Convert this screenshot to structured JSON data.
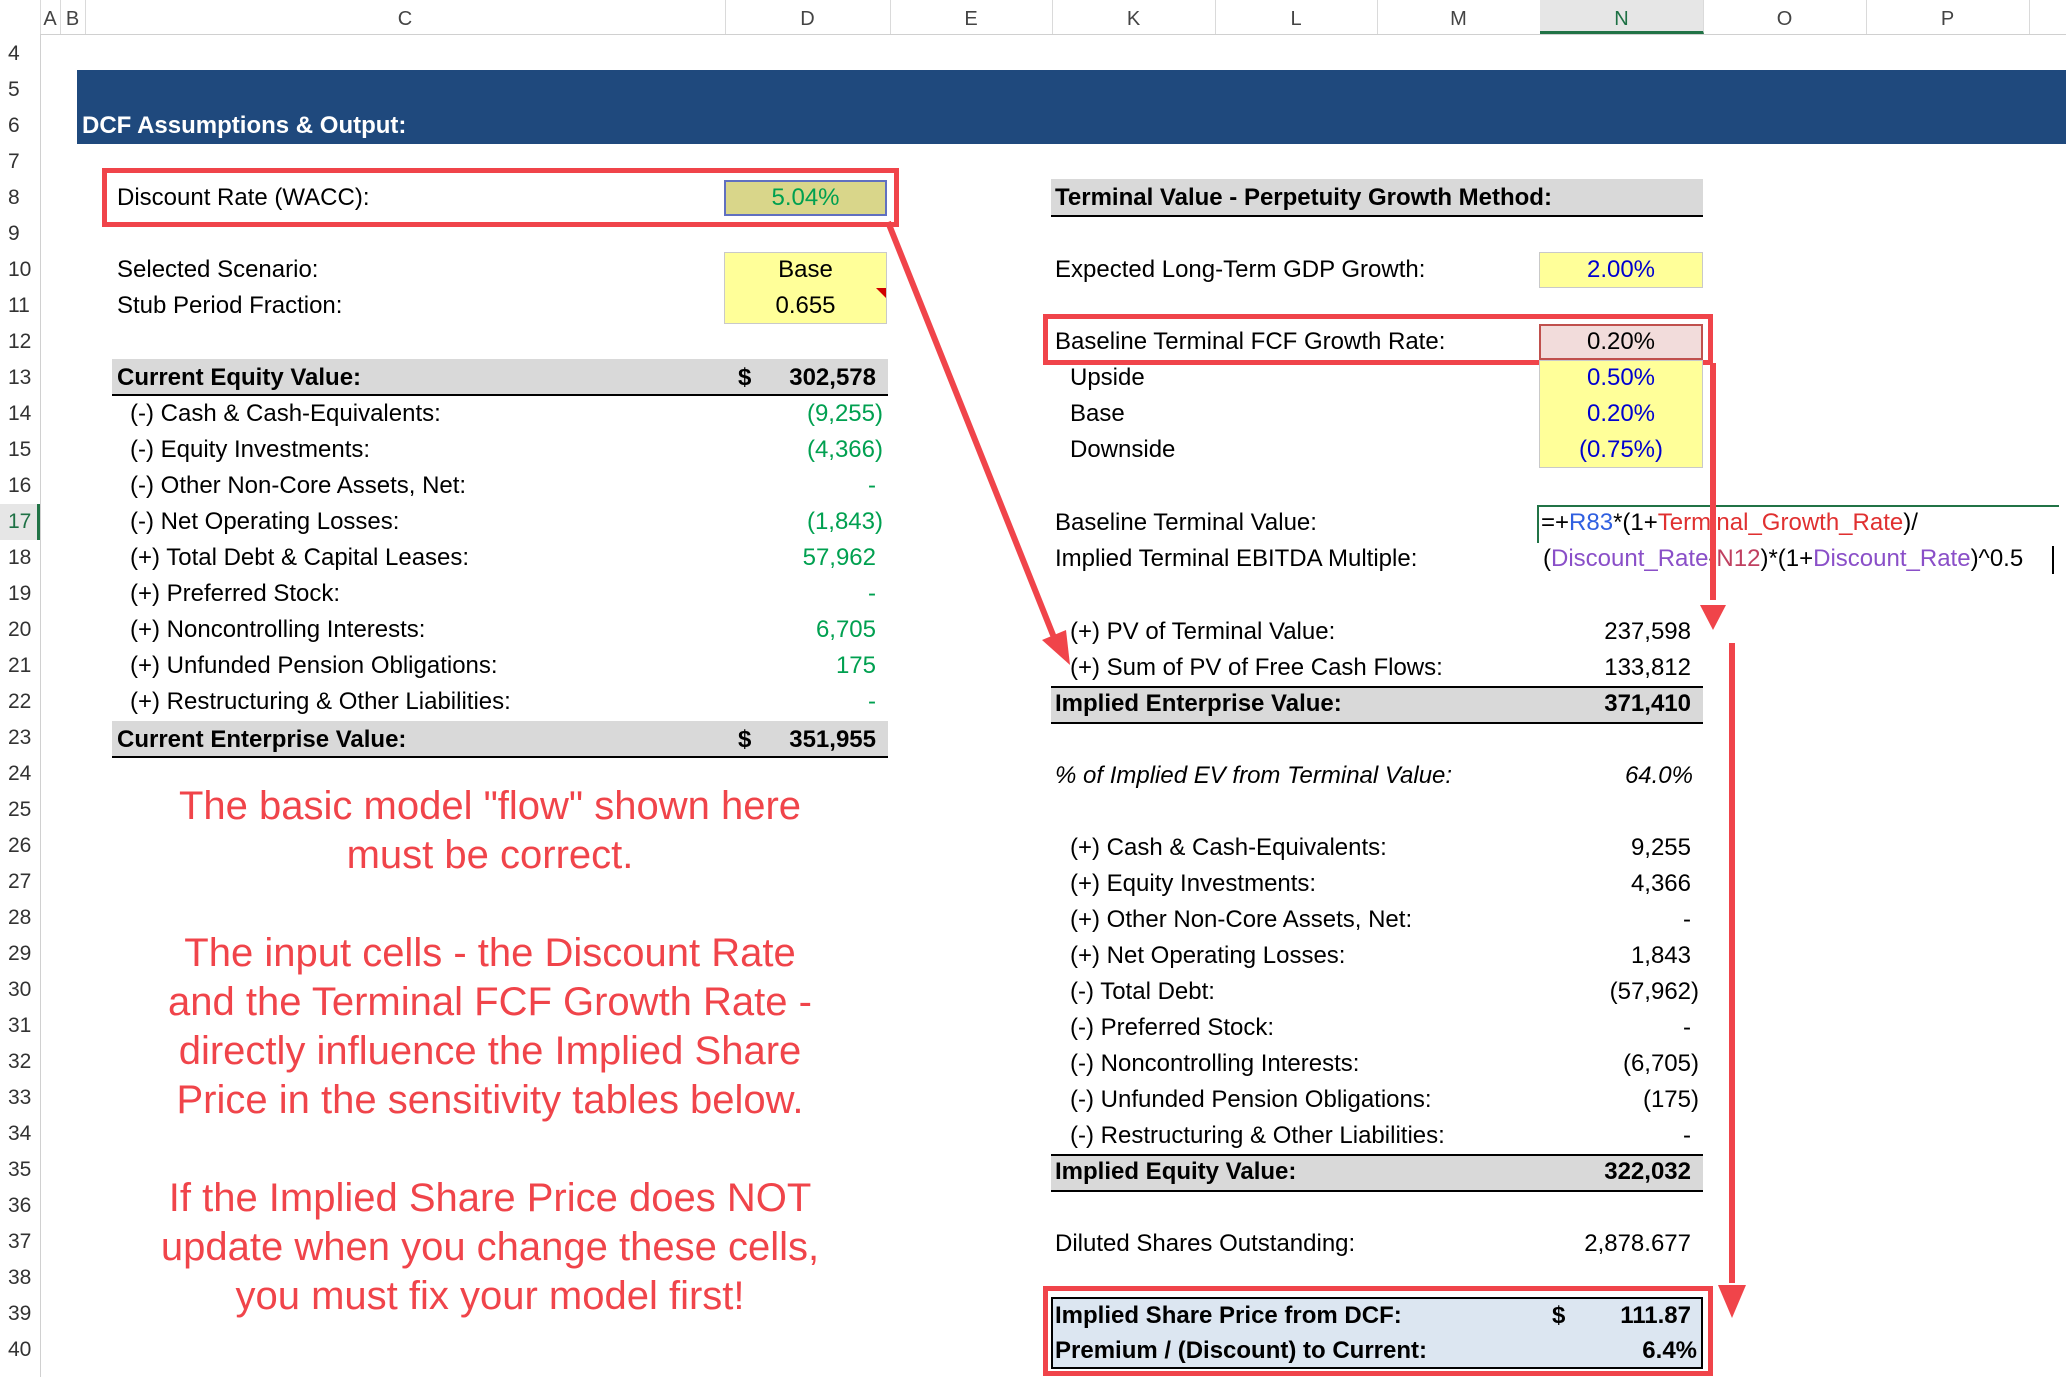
{
  "columns": [
    "A",
    "B",
    "C",
    "D",
    "E",
    "K",
    "L",
    "M",
    "N",
    "O",
    "P"
  ],
  "rows": [
    "4",
    "5",
    "6",
    "7",
    "8",
    "9",
    "10",
    "11",
    "12",
    "13",
    "14",
    "15",
    "16",
    "17",
    "18",
    "19",
    "20",
    "21",
    "22",
    "23",
    "24",
    "25",
    "26",
    "27",
    "28",
    "29",
    "30",
    "31",
    "32",
    "33",
    "34",
    "35",
    "36",
    "37",
    "38",
    "39",
    "40"
  ],
  "selected_column": "N",
  "selected_row": "17",
  "banner_title": "DCF Assumptions & Output:",
  "left": {
    "discount_label": "Discount Rate (WACC):",
    "discount_value": "5.04%",
    "scenario_label": "Selected Scenario:",
    "scenario_value": "Base",
    "stub_label": "Stub Period Fraction:",
    "stub_value": "0.655",
    "equity_label": "Current Equity Value:",
    "equity_currency": "$",
    "equity_value": "302,578",
    "items": [
      {
        "label": "(-) Cash & Cash-Equivalents:",
        "value": "(9,255)"
      },
      {
        "label": "(-) Equity Investments:",
        "value": "(4,366)"
      },
      {
        "label": "(-) Other Non-Core Assets, Net:",
        "value": "-"
      },
      {
        "label": "(-) Net Operating Losses:",
        "value": "(1,843)"
      },
      {
        "label": "(+) Total Debt & Capital Leases:",
        "value": "57,962"
      },
      {
        "label": "(+) Preferred Stock:",
        "value": "-"
      },
      {
        "label": "(+) Noncontrolling Interests:",
        "value": "6,705"
      },
      {
        "label": "(+) Unfunded Pension Obligations:",
        "value": "175"
      },
      {
        "label": "(+) Restructuring & Other Liabilities:",
        "value": "-"
      }
    ],
    "ev_label": "Current Enterprise Value:",
    "ev_currency": "$",
    "ev_value": "351,955"
  },
  "note": {
    "p1a": "The basic model \"flow\" shown here",
    "p1b": "must be correct.",
    "p2a": "The input cells - the Discount Rate",
    "p2b": "and the Terminal FCF Growth Rate -",
    "p2c": "directly influence the Implied Share",
    "p2d": "Price in the sensitivity tables below.",
    "p3a": "If the Implied Share Price does NOT",
    "p3b": "update when you change these cells,",
    "p3c": "you must fix your model first!"
  },
  "right": {
    "tv_header": "Terminal Value - Perpetuity Growth Method:",
    "gdp_label": "Expected Long-Term GDP Growth:",
    "gdp_value": "2.00%",
    "baseline_growth_label": "Baseline Terminal FCF Growth Rate:",
    "baseline_growth_value": "0.20%",
    "scenarios": [
      {
        "label": "Upside",
        "value": "0.50%"
      },
      {
        "label": "Base",
        "value": "0.20%"
      },
      {
        "label": "Downside",
        "value": "(0.75%)"
      }
    ],
    "btv_label": "Baseline Terminal Value:",
    "ebitda_label": "Implied Terminal EBITDA Multiple:",
    "formula_line1": {
      "p1": "=+",
      "p2": "R83",
      "p3": "*(1+",
      "p4": "Terminal_Growth_Rate",
      "p5": ")/"
    },
    "formula_line2": {
      "p1": "(",
      "p2": "Discount_Rate",
      "p3": "-",
      "p4": "N12",
      "p5": ")*(1+",
      "p6": "Discount_Rate",
      "p7": ")^0.5"
    },
    "pv_tv_label": "(+) PV of Terminal Value:",
    "pv_tv_value": "237,598",
    "pv_fcf_label": "(+) Sum of PV of Free Cash Flows:",
    "pv_fcf_value": "133,812",
    "iev_label": "Implied Enterprise Value:",
    "iev_value": "371,410",
    "pct_label": "% of Implied EV from Terminal Value:",
    "pct_value": "64.0%",
    "bridge": [
      {
        "label": "(+) Cash & Cash-Equivalents:",
        "value": "9,255"
      },
      {
        "label": "(+) Equity Investments:",
        "value": "4,366"
      },
      {
        "label": "(+) Other Non-Core Assets, Net:",
        "value": "-"
      },
      {
        "label": "(+) Net Operating Losses:",
        "value": "1,843"
      },
      {
        "label": "(-) Total Debt:",
        "value": "(57,962)"
      },
      {
        "label": "(-) Preferred Stock:",
        "value": "-"
      },
      {
        "label": "(-) Noncontrolling Interests:",
        "value": "(6,705)"
      },
      {
        "label": "(-) Unfunded Pension Obligations:",
        "value": "(175)"
      },
      {
        "label": "(-) Restructuring & Other Liabilities:",
        "value": "-"
      }
    ],
    "iequity_label": "Implied Equity Value:",
    "iequity_value": "322,032",
    "shares_label": "Diluted Shares Outstanding:",
    "shares_value": "2,878.677",
    "price_label": "Implied Share Price from DCF:",
    "price_currency": "$",
    "price_value": "111.87",
    "premium_label": "Premium / (Discount) to Current:",
    "premium_value": "6.4%"
  },
  "colors": {
    "banner": "#1f497d",
    "annotation_red": "#f0444a",
    "green_values": "#00a050",
    "blue_inputs": "#0000d0",
    "input_yellow": "#ffff99",
    "output_blue": "#dce6f1",
    "gray_band": "#d9d9d9"
  }
}
